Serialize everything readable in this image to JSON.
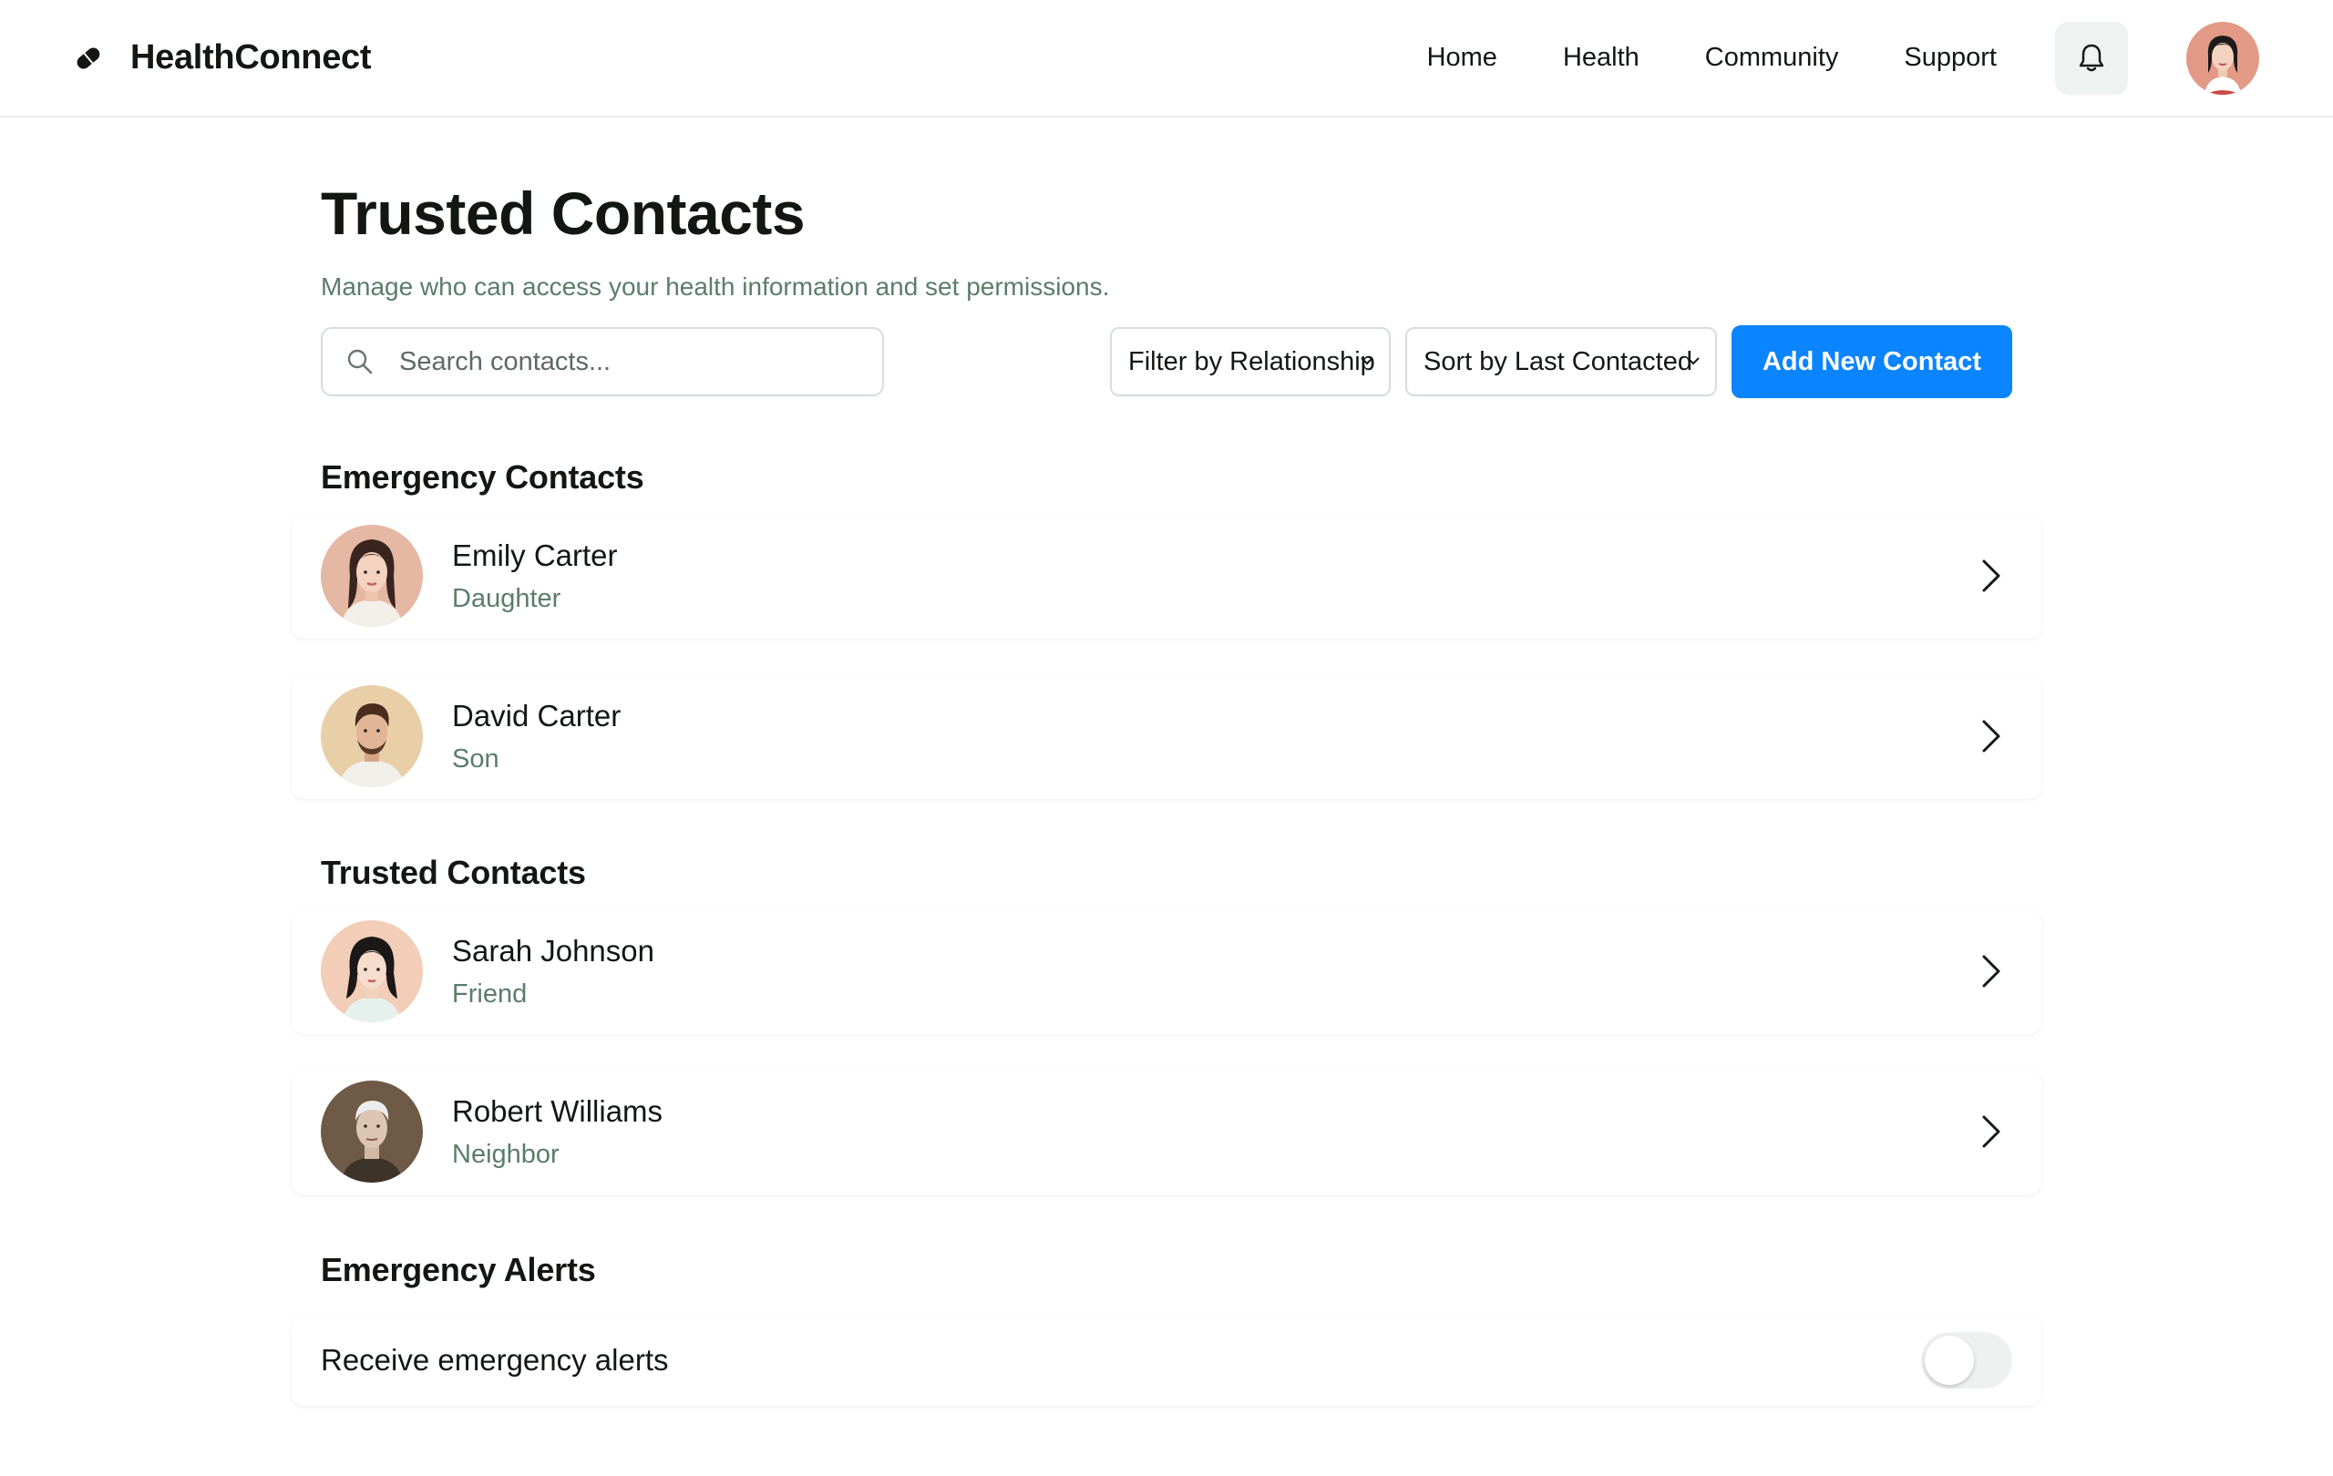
{
  "header": {
    "brand": "HealthConnect",
    "nav": [
      "Home",
      "Health",
      "Community",
      "Support"
    ]
  },
  "page": {
    "title": "Trusted Contacts",
    "subtitle": "Manage who can access your health information and set permissions."
  },
  "toolbar": {
    "search_placeholder": "Search contacts...",
    "filter_label": "Filter by Relationship",
    "sort_label": "Sort by Last Contacted",
    "add_label": "Add New Contact"
  },
  "sections": {
    "emergency": {
      "title": "Emergency Contacts",
      "contacts": [
        {
          "name": "Emily Carter",
          "relationship": "Daughter"
        },
        {
          "name": "David Carter",
          "relationship": "Son"
        }
      ]
    },
    "trusted": {
      "title": "Trusted Contacts",
      "contacts": [
        {
          "name": "Sarah Johnson",
          "relationship": "Friend"
        },
        {
          "name": "Robert Williams",
          "relationship": "Neighbor"
        }
      ]
    },
    "alerts": {
      "title": "Emergency Alerts",
      "label": "Receive emergency alerts",
      "enabled": false
    }
  },
  "colors": {
    "accent": "#0a84ff",
    "muted_green": "#5b7d6a",
    "text": "#121714"
  }
}
